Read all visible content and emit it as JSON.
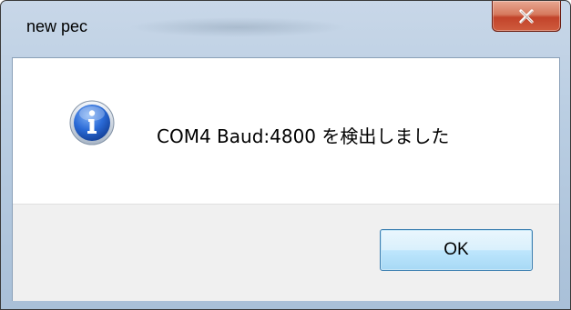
{
  "window": {
    "title": "new pec"
  },
  "dialog": {
    "icon": "info-icon",
    "message": "COM4 Baud:4800 を検出しました",
    "ok_label": "OK"
  },
  "colors": {
    "info_blue": "#1b5cc8",
    "close_red": "#c2432a",
    "ok_border": "#3c7fb1"
  }
}
